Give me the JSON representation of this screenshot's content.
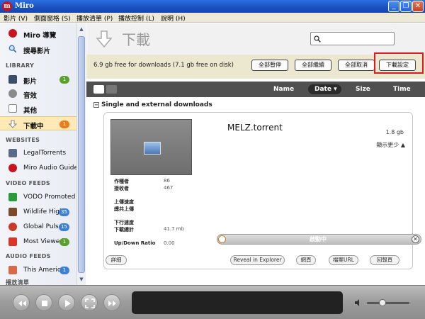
{
  "window": {
    "title": "Miro",
    "minimize": "_",
    "maximize": "❐",
    "close": "✕"
  },
  "menu": [
    "影片 (V)",
    "側面窗格 (S)",
    "播放清單 (P)",
    "播放控制 (L)",
    "說明 (H)"
  ],
  "sidebar": {
    "top": [
      {
        "label": "Miro 導覽",
        "icon": "miro-logo-icon"
      },
      {
        "label": "搜尋影片",
        "icon": "magnifier-icon"
      }
    ],
    "library_header": "LIBRARY",
    "library": [
      {
        "label": "影片",
        "badge": "1",
        "badge_color": "#5aa02c",
        "icon": "film-icon"
      },
      {
        "label": "音效",
        "icon": "speaker-icon"
      },
      {
        "label": "其他",
        "icon": "document-icon"
      },
      {
        "label": "下載中",
        "badge": "1",
        "badge_color": "#f07a1a",
        "icon": "download-icon",
        "selected": true
      }
    ],
    "websites_header": "WEBSITES",
    "websites": [
      {
        "label": "LegalTorrents",
        "icon": "legaltorrents-icon"
      },
      {
        "label": "Miro Audio Guide",
        "icon": "miro-logo-icon"
      }
    ],
    "video_feeds_header": "VIDEO FEEDS",
    "video_feeds": [
      {
        "label": "VODO Promoted",
        "icon": "vodo-icon"
      },
      {
        "label": "Wildlife High",
        "badge": "35",
        "badge_color": "#3a7fd8",
        "icon": "wildlife-icon"
      },
      {
        "label": "Global Pulse",
        "badge": "15",
        "badge_color": "#3a7fd8",
        "icon": "global-pulse-icon"
      },
      {
        "label": "Most Viewed",
        "badge": "1",
        "badge_color": "#5aa02c",
        "icon": "most-viewed-icon"
      }
    ],
    "audio_feeds_header": "AUDIO FEEDS",
    "audio_feeds": [
      {
        "label": "This America",
        "badge": "1",
        "badge_color": "#3a7fd8",
        "icon": "this-america-icon"
      }
    ],
    "next_partial": "播放清單"
  },
  "main": {
    "title": "下載",
    "search_placeholder": "",
    "free_space": "6.9 gb free for downloads (7.1 gb free on disk)",
    "buttons": [
      "全部暫停",
      "全部繼續",
      "全部取消",
      "下載設定"
    ],
    "columns": {
      "name": "Name",
      "date": "Date ▾",
      "size": "Size",
      "time": "Time"
    },
    "section_title": "Single and external downloads",
    "section_toggle": "−",
    "item": {
      "name": "MELZ.torrent",
      "size": "1.8 gb",
      "show_less": "顯示更少 ▲",
      "seeders_label": "作種者",
      "seeders": "86",
      "leechers_label": "接收者",
      "leechers": "467",
      "upload_rate_label": "上傳速度",
      "upload_total_label": "總共上傳",
      "download_rate_label": "下行速度",
      "download_total_label": "下載總計",
      "download_total": "41.7 mb",
      "ratio_label": "Up/Down Ratio",
      "ratio": "0.00",
      "status": "啟動中",
      "close": "✕",
      "buttons": {
        "details": "詳細",
        "reveal": "Reveal in Explorer",
        "web": "網頁",
        "url": "檔案URL",
        "report": "回報頁"
      }
    }
  }
}
